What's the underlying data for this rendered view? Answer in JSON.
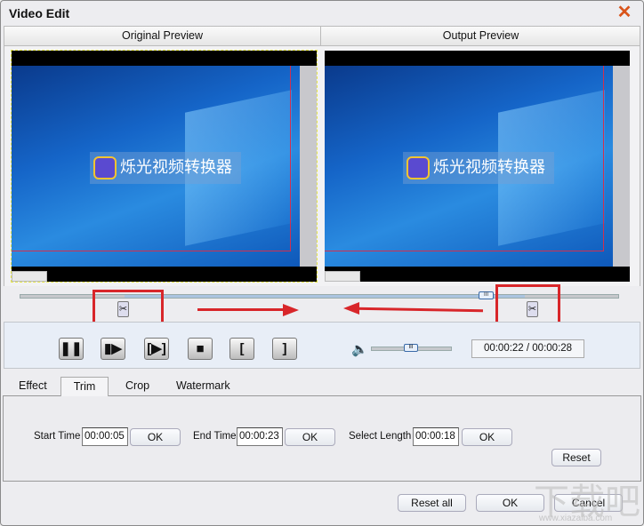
{
  "window": {
    "title": "Video Edit",
    "close_icon": "close-icon"
  },
  "preview": {
    "original_label": "Original Preview",
    "output_label": "Output Preview",
    "video_logo_text": "烁光视频转换器"
  },
  "playback": {
    "time_display": "00:00:22 / 00:00:28",
    "timeline_position": 0.78,
    "trim_start_fraction": 0.18,
    "trim_end_fraction": 0.82,
    "volume": 0.45
  },
  "tabs": [
    {
      "label": "Effect"
    },
    {
      "label": "Trim",
      "active": true
    },
    {
      "label": "Crop"
    },
    {
      "label": "Watermark"
    }
  ],
  "trim": {
    "start_label": "Start Time",
    "start_value": "00:00:05",
    "end_label": "End Time",
    "end_value": "00:00:23",
    "length_label": "Select Length",
    "length_value": "00:00:18",
    "ok_label": "OK",
    "reset_label": "Reset"
  },
  "footer": {
    "reset_all": "Reset all",
    "ok": "OK",
    "cancel": "Cancel"
  },
  "watermark": {
    "text": "下载吧",
    "url": "www.xiazaiba.com"
  },
  "colors": {
    "annotation_red": "#d8262a",
    "accent_blue": "#3a6aa8"
  }
}
